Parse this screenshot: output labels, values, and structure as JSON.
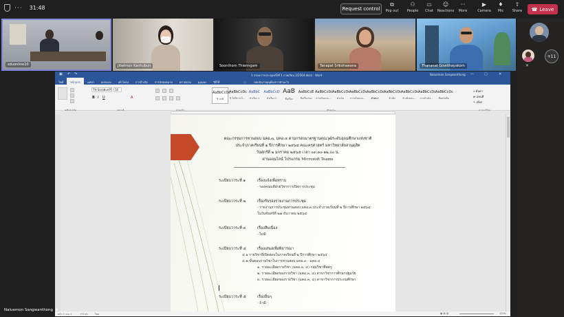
{
  "topbar": {
    "timer": "31:48",
    "request_control": "Request control",
    "buttons": [
      {
        "label": "Pop out",
        "icon": "pop-out-icon"
      },
      {
        "label": "People",
        "icon": "people-icon"
      },
      {
        "label": "Chat",
        "icon": "chat-icon"
      },
      {
        "label": "Reactions",
        "icon": "reactions-icon"
      },
      {
        "label": "More",
        "icon": "more-icon"
      },
      {
        "label": "Camera",
        "icon": "camera-icon"
      },
      {
        "label": "Mic",
        "icon": "mic-icon"
      },
      {
        "label": "Share",
        "icon": "share-icon"
      }
    ],
    "leave": "Leave"
  },
  "participants": [
    {
      "name": "sduonline10"
    },
    {
      "name": "Jitwimon Kanhubun"
    },
    {
      "name": "Soonthorn Thienngam"
    },
    {
      "name": "Tanapat Srikshawana"
    },
    {
      "name": "Thananat Gowithayakorn"
    }
  ],
  "more_participants": "+11",
  "presenter_name": "Naluemon Sangwanthong",
  "colors": {
    "accent_blue": "#2b579a",
    "leave_red": "#c4314b",
    "arrow_red": "#c44a2a"
  },
  "word": {
    "title": "1 กรอบการประชุมครั้งที่ 1 ภาคเรียน 2/2564.docx - Word",
    "user": "Naluemon Sangwanthong",
    "tabs": [
      "ไฟล์",
      "หน้าแรก",
      "แทรก",
      "ออกแบบ",
      "เค้าโครง",
      "การอ้างอิง",
      "การส่งจดหมาย",
      "ตรวจทาน",
      "มุมมอง",
      "วิธีใช้"
    ],
    "tell_me": "บอกฉันว่าคุณต้องการทำอะไร",
    "font_name": "TH SarabunPSK",
    "font_size": "16",
    "styles": [
      {
        "preview": "AaBbCcDc",
        "name": "¶ ปกติ"
      },
      {
        "preview": "AaBbCcDc",
        "name": "¶ ไม่มีการเว้..."
      },
      {
        "preview": "AaBbC",
        "name": "หัวเรื่อง 1"
      },
      {
        "preview": "AaBbCcD",
        "name": "หัวเรื่อง 2"
      },
      {
        "preview": "AaB",
        "name": "ชื่อเรื่อง"
      },
      {
        "preview": "AaBbCcE",
        "name": "ชื่อเรื่องรอง"
      },
      {
        "preview": "AaBbCcDc",
        "name": "การเน้นแบบ..."
      },
      {
        "preview": "AaBbCcDc",
        "name": "ตัวเน้น"
      },
      {
        "preview": "AaBbCcDc",
        "name": "การเน้นแบบ..."
      },
      {
        "preview": "AaBbCcDc",
        "name": "ตัวหนา"
      },
      {
        "preview": "AaBbCcDc",
        "name": "อ้างอิง"
      },
      {
        "preview": "AaBbCcDc",
        "name": "อ้างอิงแบบ..."
      },
      {
        "preview": "AaBbCcDc",
        "name": "การอ้างอิง..."
      },
      {
        "preview": "AaBbCcDc",
        "name": "ชื่อหนังสือ"
      }
    ],
    "groups": {
      "clipboard": "คลิปบอร์ด",
      "font": "ฟอนต์",
      "paragraph": "ย่อหน้า",
      "styles": "ลักษณะ",
      "editing": "การแก้ไข"
    },
    "editing": [
      "ค้นหา",
      "แทนที่",
      "เลือก"
    ],
    "status": {
      "page": "หน้า 1 จาก 1",
      "words": "179 คำ",
      "lang": "ไทย",
      "zoom": "120%"
    }
  },
  "doc": {
    "header": [
      "คณะกรรมการทวนสอบ มคอ.๓, มคอ.๔ ตามกรอบมาตรฐานคุณวุฒิระดับอุดมศึกษาแห่งชาติ",
      "ประจำภาคเรียนที่ ๑ ปีการศึกษา ๒๕๖๔ คณะครุศาสตร์ มหาวิทยาลัยสวนดุสิต",
      "วันศุกร์ที่ ๒ มกราคม ๒๕๖๕ เวลา ๐๙.๓๐-๑๒.๐๐ น.",
      "ผ่านออนไลน์ โปรแกรม Microsoft Teams"
    ],
    "agenda": [
      {
        "label": "ระเบียบวาระที่ ๑",
        "title": "เรื่องแจ้งเพื่อทราบ",
        "items": [
          "- รองคณบดีฝ่ายวิชาการเปิดการประชุม"
        ]
      },
      {
        "label": "ระเบียบวาระที่ ๒",
        "title": "เรื่องรับรองรายงานการประชุม",
        "items": [
          "- รายงานการประชุมทวนสอบ มคอ.๓ ประจำภาคเรียนที่ ๒ ปีการศึกษา ๒๕๖๔",
          "ในวันจันทร์ที่ ๒๗ ธันวาคม ๒๕๖๔"
        ]
      },
      {
        "label": "ระเบียบวาระที่ ๓",
        "title": "เรื่องสืบเนื่อง",
        "items": [
          "- ไม่มี-"
        ]
      },
      {
        "label": "ระเบียบวาระที่ ๔",
        "title": "เรื่องเสนอเพื่อพิจารณา",
        "items": [
          "๔.๑   รายวิชาที่เปิดสอนในภาคเรียนที่ ๒ ปีการศึกษา ๒๕๖๔",
          "๔.๒   ขั้นตอนรายวิชาในการทวนสอบ มคอ.๓ - มคอ.๔",
          "๑. รายละเอียดรายวิชา (มคอ.๓, ๔) กลุ่มวิชาชีพครู",
          "๒. รายละเอียดของรายวิชา (มคอ.๓, ๔) สาขาวิชาการศึกษาปฐมวัย",
          "๓. รายละเอียดของรายวิชา (มคอ.๓, ๔) สาขาวิชาการประถมศึกษา"
        ]
      },
      {
        "label": "ระเบียบวาระที่ ๕",
        "title": "เรื่องอื่นๆ",
        "items": [
          "- ถ้ามี-"
        ]
      }
    ]
  }
}
